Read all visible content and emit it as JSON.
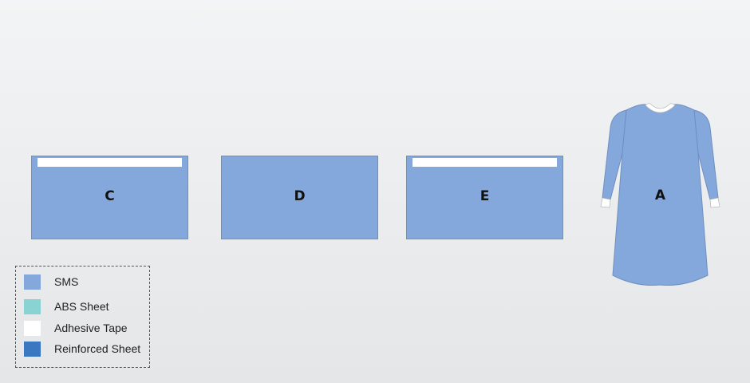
{
  "drapes": [
    {
      "id": "c",
      "label": "C",
      "has_tape": true
    },
    {
      "id": "d",
      "label": "D",
      "has_tape": false
    },
    {
      "id": "e",
      "label": "E",
      "has_tape": true
    }
  ],
  "gown": {
    "label": "A"
  },
  "legend": {
    "items": [
      {
        "label": "SMS",
        "color": "#84a8db"
      },
      {
        "label": "ABS Sheet",
        "color": "#8ad3d3"
      },
      {
        "label": "Adhesive Tape",
        "color": "#ffffff"
      },
      {
        "label": "Reinforced Sheet",
        "color": "#3a78c2"
      }
    ]
  },
  "colors": {
    "sms": "#84a8db",
    "abs_sheet": "#8ad3d3",
    "adhesive_tape": "#ffffff",
    "reinforced_sheet": "#3a78c2"
  }
}
